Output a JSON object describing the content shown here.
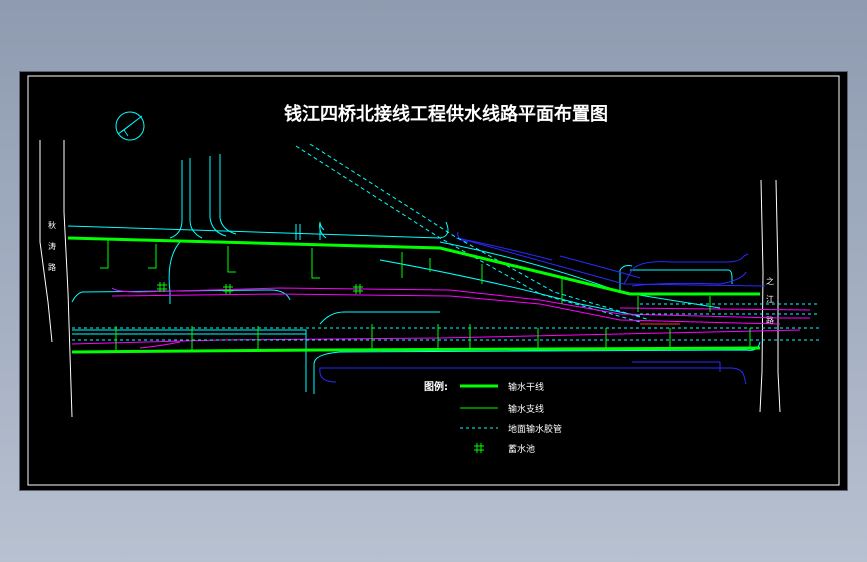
{
  "drawing": {
    "title": "钱江四桥北接线工程供水线路平面布置图",
    "road_labels": {
      "left": [
        "秋",
        "涛",
        "路"
      ],
      "right": [
        "之",
        "江",
        "路"
      ]
    }
  },
  "legend": {
    "heading": "图例:",
    "items": [
      {
        "label": "输水干线",
        "color": "#00ff00",
        "style": "thick-solid"
      },
      {
        "label": "输水支线",
        "color": "#00ff00",
        "style": "thin-solid"
      },
      {
        "label": "地面输水胶管",
        "color": "#00ffff",
        "style": "dashed"
      },
      {
        "label": "蓄水池",
        "color": "#00ff00",
        "style": "hash-symbol"
      }
    ]
  },
  "colors": {
    "background": "#000000",
    "frame": "#ffffff",
    "main_line": "#00ff00",
    "cyan": "#00ffff",
    "blue": "#2a2aff",
    "magenta": "#ff00ff"
  },
  "icons": {
    "north_arrow": "north-arrow-icon",
    "reservoir": "hash-icon"
  }
}
